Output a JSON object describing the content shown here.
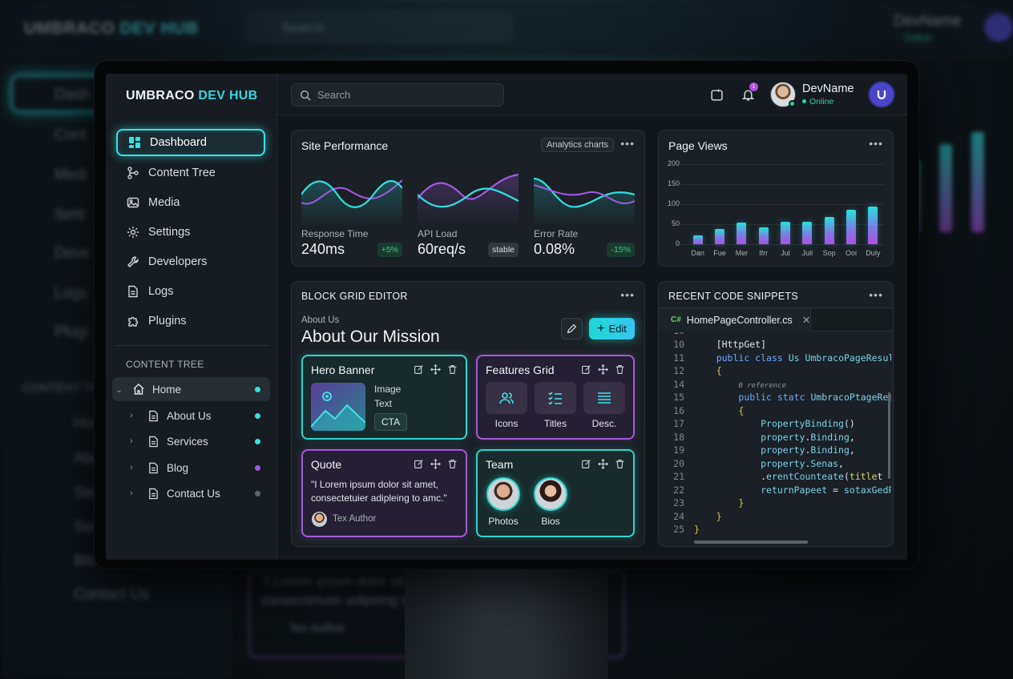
{
  "background": {
    "brand_prefix": "UMBRACO",
    "brand_suffix": "DEV HUB",
    "search_placeholder": "Search",
    "user_name": "DevName",
    "user_status": "Online",
    "nav": [
      "Dash",
      "Cont",
      "Medi",
      "Setti",
      "Deve",
      "Logs",
      "Plugi"
    ],
    "section": "CONTENT TR",
    "tree": [
      "Home",
      "Abo",
      "Ser",
      "Ser",
      "Blo",
      "Contact Us"
    ],
    "quote": "\"I Lorem ipsum dolor sit a",
    "quote2": "consectetuier adipeing to",
    "author": "Tex Author"
  },
  "brand": {
    "prefix": "UMBRACO",
    "suffix": "DEV HUB"
  },
  "sidebar": {
    "items": [
      {
        "label": "Dashboard",
        "icon": "dashboard-icon",
        "active": true
      },
      {
        "label": "Content Tree",
        "icon": "content-tree-icon"
      },
      {
        "label": "Media",
        "icon": "media-icon"
      },
      {
        "label": "Settings",
        "icon": "gear-icon"
      },
      {
        "label": "Developers",
        "icon": "wrench-icon"
      },
      {
        "label": "Logs",
        "icon": "file-icon"
      },
      {
        "label": "Plugins",
        "icon": "puzzle-icon"
      }
    ],
    "section_label": "CONTENT TREE",
    "tree": [
      {
        "label": "Home",
        "dot": "#36e2e2"
      },
      {
        "label": "About Us",
        "dot": "#36e2e2"
      },
      {
        "label": "Services",
        "dot": "#36e2e2"
      },
      {
        "label": "Blog",
        "dot": "#a45ad8"
      },
      {
        "label": "Contact Us",
        "dot": "#5d666c"
      }
    ]
  },
  "topbar": {
    "search_placeholder": "Search",
    "notification_count": "1",
    "user_name": "DevName",
    "user_status": "Online"
  },
  "site_performance": {
    "title": "Site Performance",
    "pill": "Analytics charts",
    "metrics": [
      {
        "label": "Response Time",
        "value": "240ms",
        "badge": "+5%",
        "badge_color": "#2fd28a"
      },
      {
        "label": "API Load",
        "value": "60req/s",
        "badge": "stable",
        "badge_color": "#d6dde2"
      },
      {
        "label": "Error Rate",
        "value": "0.08%",
        "badge": "-15%",
        "badge_color": "#2fd28a"
      }
    ]
  },
  "page_views": {
    "title": "Page Views"
  },
  "chart_data": {
    "type": "bar",
    "title": "Page Views",
    "categories": [
      "Dan",
      "Fue",
      "Mer",
      "Ifrr",
      "Jul",
      "Juli",
      "Sop",
      "Ooi",
      "Duly"
    ],
    "values": [
      23,
      38,
      54,
      43,
      57,
      56,
      69,
      86,
      94
    ],
    "yticks": [
      "200",
      "150",
      "100",
      "50",
      "0"
    ],
    "ylim": [
      0,
      200
    ],
    "grid": true,
    "legend": "none"
  },
  "block_grid": {
    "title": "BLOCK GRID EDITOR",
    "eyebrow": "About Us",
    "heading": "About Our Mission",
    "edit_label": "Edit",
    "hero": {
      "title": "Hero Banner",
      "line1": "Image",
      "line2": "Text",
      "cta": "CTA"
    },
    "features": {
      "title": "Features Grid",
      "tiles": [
        "Icons",
        "Titles",
        "Desc."
      ]
    },
    "quote": {
      "title": "Quote",
      "text": "\"I Lorem ipsum dolor sit amet, consectetuier adipleing to amc.\"",
      "author": "Tex Author"
    },
    "team": {
      "title": "Team",
      "members": [
        "Photos",
        "Bios"
      ]
    }
  },
  "code": {
    "title": "RECENT CODE SNIPPETS",
    "tab": "HomePageController.cs",
    "tab_badge": "C#",
    "lines": [
      {
        "n": "10",
        "html": "    <span class='pl'>[HttpGet]</span>"
      },
      {
        "n": "11",
        "html": "    <span class='kw'>public class</span> <span class='ty'>Us</span> <span class='ty'>UmbracoPageResult</span>"
      },
      {
        "n": "12",
        "html": "    <span class='br'>{</span>"
      },
      {
        "n": "14",
        "html": "        <span class='ref'>0 reference</span>"
      },
      {
        "n": "15",
        "html": "        <span class='kw'>public</span> <span class='kw'>statc</span> <span class='ty'>UmbracoPtageResult</span>"
      },
      {
        "n": "16",
        "html": "        <span class='br'>{</span>"
      },
      {
        "n": "17",
        "html": "            <span class='ty'>PropertyBinding</span><span class='pl'>()</span>"
      },
      {
        "n": "18",
        "html": "            <span class='ty'>property</span><span class='pl'>.</span><span class='ty'>Binding</span><span class='pl'>,</span>"
      },
      {
        "n": "19",
        "html": "            <span class='ty'>property</span><span class='pl'>.</span><span class='ty'>Binding</span><span class='pl'>,</span>"
      },
      {
        "n": "20",
        "html": "            <span class='ty'>property</span><span class='pl'>.</span><span class='ty'>Senas</span><span class='pl'>,</span>"
      },
      {
        "n": "21",
        "html": "            <span class='pl'>.</span><span class='ty'>erentCounteate</span><span class='pl'>(</span><span class='fn'>title</span><span class='pl'>t</span>"
      },
      {
        "n": "22",
        "html": "            <span class='ty'>returnPapeet</span> <span class='pl'>=</span> <span class='ty'>sotaxGedPage</span>"
      },
      {
        "n": "23",
        "html": "        <span class='br'>}</span>"
      },
      {
        "n": "24",
        "html": "    <span class='br'>}</span>"
      },
      {
        "n": "25",
        "html": "<span class='br'>}</span>"
      }
    ]
  }
}
